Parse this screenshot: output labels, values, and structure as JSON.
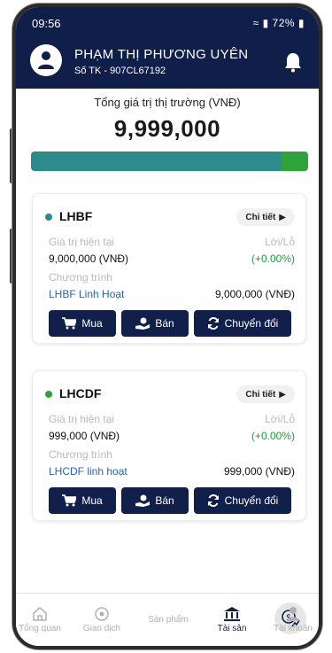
{
  "status_bar": {
    "time": "09:56",
    "battery": "72%"
  },
  "header": {
    "user_name": "PHẠM THỊ PHƯƠNG UYÊN",
    "account_label": "Số TK - 907CL67192"
  },
  "portfolio": {
    "market_value_label": "Tổng giá trị thị trường (VNĐ)",
    "market_value": "9,999,000",
    "allocation": [
      {
        "fund": "LHBF",
        "share": 0.9,
        "color": "#2e8b8b"
      },
      {
        "fund": "LHCDF",
        "share": 0.1,
        "color": "#2da33a"
      }
    ]
  },
  "funds": [
    {
      "name": "LHBF",
      "dot_color": "#2e8b8b",
      "detail_label": "Chi tiết",
      "current_value_label": "Giá trị hiện tại",
      "current_value": "9,000,000 (VNĐ)",
      "pnl_label": "Lời/Lỗ",
      "pnl": "(+0.00%)",
      "program_label": "Chương trình",
      "program_name": "LHBF Linh Hoạt",
      "program_value": "9,000,000 (VNĐ)"
    },
    {
      "name": "LHCDF",
      "dot_color": "#2da33a",
      "detail_label": "Chi tiết",
      "current_value_label": "Giá trị hiện tại",
      "current_value": "999,000 (VNĐ)",
      "pnl_label": "Lời/Lỗ",
      "pnl": "(+0.00%)",
      "program_label": "Chương trình",
      "program_name": "LHCDF linh hoạt",
      "program_value": "999,000 (VNĐ)"
    }
  ],
  "actions": {
    "buy": "Mua",
    "sell": "Bán",
    "convert": "Chuyển đổi"
  },
  "tabs": [
    {
      "label": "Tổng quan",
      "icon": "home-icon"
    },
    {
      "label": "Giao dịch",
      "icon": "transaction-icon"
    },
    {
      "label": "Sản phẩm",
      "icon": "product-icon"
    },
    {
      "label": "Tài sản",
      "icon": "asset-icon",
      "active": true
    },
    {
      "label": "Tài khoản",
      "icon": "account-icon"
    }
  ]
}
